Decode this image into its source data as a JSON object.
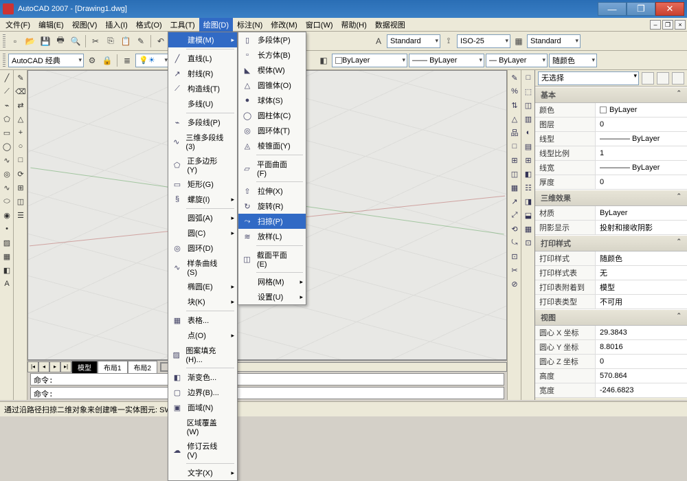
{
  "window": {
    "title": "AutoCAD 2007 - [Drawing1.dwg]",
    "min": "—",
    "max": "❐",
    "close": "✕"
  },
  "menus": [
    "文件(F)",
    "编辑(E)",
    "视图(V)",
    "插入(I)",
    "格式(O)",
    "工具(T)",
    "绘图(D)",
    "标注(N)",
    "修改(M)",
    "窗口(W)",
    "帮助(H)",
    "数据视图"
  ],
  "menu_open_index": 6,
  "toolbar1": {
    "style_combo": "Standard",
    "dim_combo": "ISO-25",
    "table_combo": "Standard"
  },
  "toolbar2": {
    "workspace": "AutoCAD 经典",
    "layer_color_combo": "ByLayer",
    "linetype_combo": "ByLayer",
    "lineweight_combo": "ByLayer",
    "color_combo": "随颜色"
  },
  "dd_draw": [
    {
      "label": "建模(M)",
      "icon": "",
      "arrow": true,
      "hl": true
    },
    {
      "sep": true
    },
    {
      "label": "直线(L)",
      "icon": "╱"
    },
    {
      "label": "射线(R)",
      "icon": "↗"
    },
    {
      "label": "构造线(T)",
      "icon": "⟋"
    },
    {
      "label": "多线(U)",
      "icon": ""
    },
    {
      "sep": true
    },
    {
      "label": "多段线(P)",
      "icon": "⌁"
    },
    {
      "label": "三维多段线(3)",
      "icon": "∿"
    },
    {
      "label": "正多边形(Y)",
      "icon": "⬠"
    },
    {
      "label": "矩形(G)",
      "icon": "▭"
    },
    {
      "label": "螺旋(I)",
      "icon": "§",
      "arrow": true
    },
    {
      "sep": true
    },
    {
      "label": "圆弧(A)",
      "icon": "",
      "arrow": true
    },
    {
      "label": "圆(C)",
      "icon": "",
      "arrow": true
    },
    {
      "label": "圆环(D)",
      "icon": "◎"
    },
    {
      "label": "样条曲线(S)",
      "icon": "∿"
    },
    {
      "label": "椭圆(E)",
      "icon": "",
      "arrow": true
    },
    {
      "label": "块(K)",
      "icon": "",
      "arrow": true
    },
    {
      "sep": true
    },
    {
      "label": "表格...",
      "icon": "▦"
    },
    {
      "label": "点(O)",
      "icon": "",
      "arrow": true
    },
    {
      "label": "图案填充(H)...",
      "icon": "▨"
    },
    {
      "sep": true
    },
    {
      "label": "渐变色...",
      "icon": "◧"
    },
    {
      "label": "边界(B)...",
      "icon": "▢"
    },
    {
      "label": "面域(N)",
      "icon": "▣"
    },
    {
      "label": "区域覆盖(W)",
      "icon": ""
    },
    {
      "label": "修订云线(V)",
      "icon": "☁"
    },
    {
      "sep": true
    },
    {
      "label": "文字(X)",
      "icon": "",
      "arrow": true
    }
  ],
  "dd_model": [
    {
      "label": "多段体(P)",
      "icon": "▯"
    },
    {
      "label": "长方体(B)",
      "icon": "▫"
    },
    {
      "label": "楔体(W)",
      "icon": "◣"
    },
    {
      "label": "圆锥体(O)",
      "icon": "△"
    },
    {
      "label": "球体(S)",
      "icon": "●"
    },
    {
      "label": "圆柱体(C)",
      "icon": "◯"
    },
    {
      "label": "圆环体(T)",
      "icon": "◎"
    },
    {
      "label": "棱锥面(Y)",
      "icon": "◬"
    },
    {
      "sep": true
    },
    {
      "label": "平面曲面(F)",
      "icon": "▱"
    },
    {
      "sep": true
    },
    {
      "label": "拉伸(X)",
      "icon": "⇧"
    },
    {
      "label": "旋转(R)",
      "icon": "↻"
    },
    {
      "label": "扫掠(P)",
      "icon": "⤳",
      "hl": true
    },
    {
      "label": "放样(L)",
      "icon": "≋"
    },
    {
      "sep": true
    },
    {
      "label": "截面平面(E)",
      "icon": "◫"
    },
    {
      "sep": true
    },
    {
      "label": "网格(M)",
      "icon": "",
      "arrow": true
    },
    {
      "label": "设置(U)",
      "icon": "",
      "arrow": true
    }
  ],
  "model_tabs": {
    "active": "模型",
    "others": [
      "布局1",
      "布局2"
    ]
  },
  "cmd1": "命令:",
  "cmd2": "命令:",
  "status": "通过沿路径扫掠二维对象来创建唯一实体图元: SWEEP",
  "palette": {
    "selection": "无选择",
    "groups": [
      {
        "title": "基本",
        "rows": [
          {
            "k": "颜色",
            "v": "ByLayer",
            "swatch": true
          },
          {
            "k": "图层",
            "v": "0"
          },
          {
            "k": "线型",
            "v": "———— ByLayer"
          },
          {
            "k": "线型比例",
            "v": "1"
          },
          {
            "k": "线宽",
            "v": "———— ByLayer"
          },
          {
            "k": "厚度",
            "v": "0"
          }
        ]
      },
      {
        "title": "三维效果",
        "rows": [
          {
            "k": "材质",
            "v": "ByLayer"
          },
          {
            "k": "阴影显示",
            "v": "投射和接收阴影"
          }
        ]
      },
      {
        "title": "打印样式",
        "rows": [
          {
            "k": "打印样式",
            "v": "随颜色"
          },
          {
            "k": "打印样式表",
            "v": "无"
          },
          {
            "k": "打印表附着到",
            "v": "模型"
          },
          {
            "k": "打印表类型",
            "v": "不可用"
          }
        ]
      },
      {
        "title": "视图",
        "rows": [
          {
            "k": "圆心 X 坐标",
            "v": "29.3843"
          },
          {
            "k": "圆心 Y 坐标",
            "v": "8.8016"
          },
          {
            "k": "圆心 Z 坐标",
            "v": "0"
          },
          {
            "k": "高度",
            "v": "570.864"
          },
          {
            "k": "宽度",
            "v": "-246.6823"
          }
        ]
      }
    ]
  },
  "left_tools": [
    "╱",
    "⟋",
    "⌁",
    "⬠",
    "▭",
    "◯",
    "∿",
    "◎",
    "∿",
    "⬭",
    "◉",
    "•",
    "▨",
    "▦",
    "◧",
    "A"
  ],
  "left_tools2": [
    "✎",
    "⌫",
    "⇄",
    "△",
    "+",
    "○",
    "□",
    "⟳",
    "⊞",
    "◫",
    "☰"
  ],
  "right_tools1": [
    "✎",
    "%",
    "⇅",
    "△",
    "品",
    "□",
    "⊞",
    "◫",
    "▦",
    "↗",
    "⤢",
    "⟲",
    "⤿",
    "⊡",
    "✂",
    "⊘"
  ],
  "right_tools2": [
    "□",
    "⬚",
    "◫",
    "▥",
    "◐",
    "▤",
    "⊞",
    "◧",
    "☷",
    "◨",
    "⬓",
    "▦",
    "⊡"
  ]
}
